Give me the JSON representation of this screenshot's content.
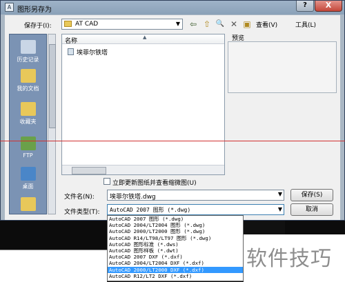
{
  "window": {
    "title": "图形另存为",
    "help": "?",
    "close": "X"
  },
  "save_in": {
    "label": "保存于(I):",
    "value": "AT CAD"
  },
  "toolbar": {
    "back": "⇦",
    "up": "⇧",
    "search": "🔍",
    "delete": "✕",
    "newfolder": "▣",
    "views": "查看(V)",
    "tools": "工具(L)"
  },
  "places": [
    {
      "label": "历史记录",
      "color": "#c9d6e6"
    },
    {
      "label": "我的文档",
      "color": "#e8c85a"
    },
    {
      "label": "收藏夹",
      "color": "#e8c85a"
    },
    {
      "label": "FTP",
      "color": "#6aa04a"
    },
    {
      "label": "桌面",
      "color": "#4a86c8"
    },
    {
      "label": "",
      "color": "#e8c85a"
    }
  ],
  "filelist": {
    "column": "名称",
    "files": [
      "埃菲尔铁塔"
    ]
  },
  "preview": {
    "label": "预览"
  },
  "update_checkbox": {
    "label": "立即更新图纸并查看缩微图(U)",
    "checked": false
  },
  "filename": {
    "label": "文件名(N):",
    "value": "埃菲尔铁塔.dwg"
  },
  "filetype": {
    "label": "文件类型(T):",
    "value": "AutoCAD 2007 图形 (*.dwg)",
    "options": [
      "AutoCAD 2007 图形 (*.dwg)",
      "AutoCAD 2004/LT2004 图形 (*.dwg)",
      "AutoCAD 2000/LT2000 图形 (*.dwg)",
      "AutoCAD R14/LT98/LT97 图形 (*.dwg)",
      "AutoCAD 图形标准 (*.dws)",
      "AutoCAD 图形样板 (*.dwt)",
      "AutoCAD 2007 DXF (*.dxf)",
      "AutoCAD 2004/LT2004 DXF (*.dxf)",
      "AutoCAD 2000/LT2000 DXF (*.dxf)",
      "AutoCAD R12/LT2 DXF (*.dxf)"
    ],
    "highlighted_index": 8
  },
  "buttons": {
    "save": "保存(S)",
    "cancel": "取消"
  },
  "watermark": "软件技巧",
  "colors": {
    "places_bg": "#7b93b4",
    "highlight": "#3399ff",
    "close": "#c4473a"
  }
}
